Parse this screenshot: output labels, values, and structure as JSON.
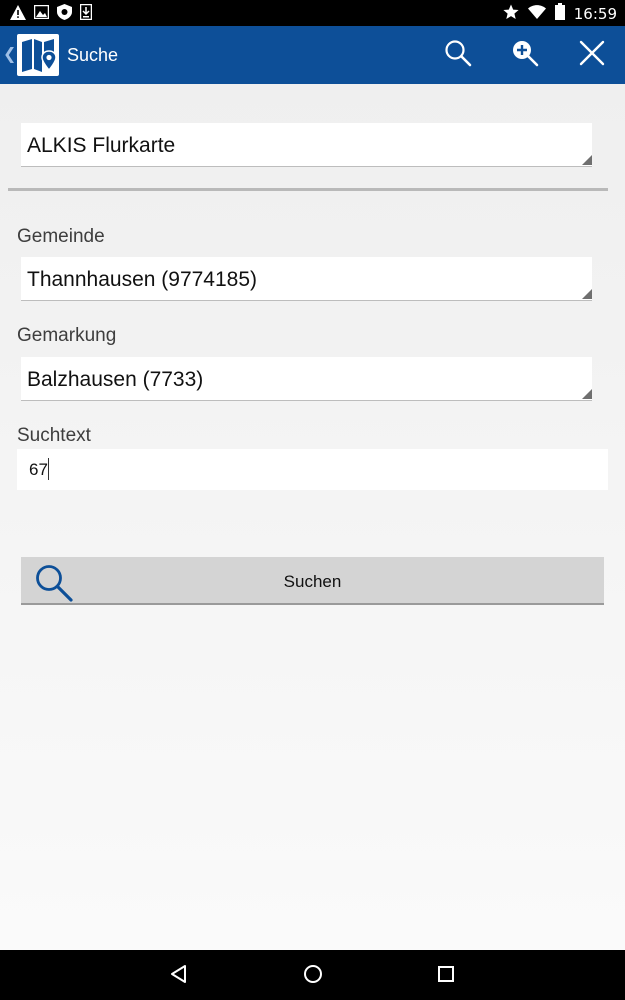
{
  "status_bar": {
    "time": "16:59",
    "left_icons": [
      "warning-icon",
      "image-icon",
      "shield-icon",
      "download-icon"
    ],
    "right_icons": [
      "star-icon",
      "wifi-icon",
      "battery-icon"
    ]
  },
  "app_bar": {
    "title": "Suche",
    "actions": [
      "search-icon",
      "zoom-in-icon",
      "close-icon"
    ],
    "colors": {
      "background": "#0d4f98"
    }
  },
  "form": {
    "layer_select": {
      "value": "ALKIS Flurkarte"
    },
    "gemeinde": {
      "label": "Gemeinde",
      "value": "Thannhausen (9774185)"
    },
    "gemarkung": {
      "label": "Gemarkung",
      "value": "Balzhausen (7733)"
    },
    "suchtext": {
      "label": "Suchtext",
      "value": "67"
    },
    "submit": {
      "label": "Suchen"
    }
  },
  "nav_bar": {
    "buttons": [
      "back-triangle-icon",
      "home-circle-icon",
      "recents-square-icon"
    ]
  }
}
